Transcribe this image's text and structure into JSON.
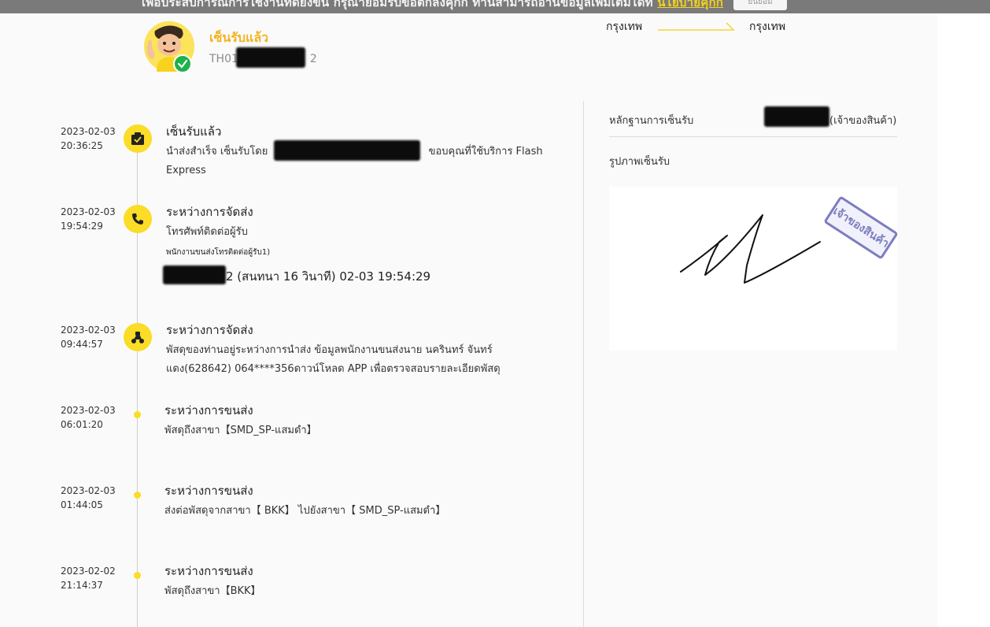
{
  "cookie_bar": {
    "text": "เพื่อประสบการณ์การใช้งานที่ดียิ่งขึ้น กรุณายอมรับข้อตกลงคุกกี้ ท่านสามารถอ่านข้อมูลเพิ่มเติมได้ที่",
    "link": "นโยบายคุกกี้",
    "accept_label": "ยินยอม"
  },
  "header": {
    "status_title": "เซ็นรับแล้ว",
    "tracking_prefix": "TH01",
    "tracking_suffix": "2",
    "route_from": "กรุงเทพ",
    "route_to": "กรุงเทพ"
  },
  "timeline": [
    {
      "date": "2023-02-03",
      "time": "20:36:25",
      "title": "เซ็นรับแล้ว",
      "desc_line1_a": "นำส่งสำเร็จ เซ็นรับโดย",
      "desc_line1_b": "ขอบคุณที่ใช้บริการ Flash",
      "desc_line2": "Express",
      "icon": "package-check-icon"
    },
    {
      "date": "2023-02-03",
      "time": "19:54:29",
      "title": "ระหว่างการจัดส่ง",
      "desc": "โทรศัพท์ติดต่อผู้รับ",
      "sub": "พนักงานขนส่งโทรติดต่อผู้รับ1)",
      "call_info": "2 (สนทนา 16 วินาที) 02-03 19:54:29",
      "icon": "phone-icon"
    },
    {
      "date": "2023-02-03",
      "time": "09:44:57",
      "title": "ระหว่างการจัดส่ง",
      "desc_line1": "พัสดุของท่านอยู่ระหว่างการนำส่ง ข้อมูลพนักงานขนส่งนาย นครินทร์ จันทร์",
      "desc_line2": "แดง(628642) 064****356ดาวน์โหลด APP เพื่อตรวจสอบรายละเอียดพัสดุ",
      "icon": "scooter-icon"
    },
    {
      "date": "2023-02-03",
      "time": "06:01:20",
      "title": "ระหว่างการขนส่ง",
      "desc": "พัสดุถึงสาขา【SMD_SP-แสมดำ】"
    },
    {
      "date": "2023-02-03",
      "time": "01:44:05",
      "title": "ระหว่างการขนส่ง",
      "desc": "ส่งต่อพัสดุจากสาขา【 BKK】 ไปยังสาขา【 SMD_SP-แสมดำ】"
    },
    {
      "date": "2023-02-02",
      "time": "21:14:37",
      "title": "ระหว่างการขนส่ง",
      "desc": "พัสดุถึงสาขา【BKK】"
    }
  ],
  "proof": {
    "label": "หลักฐานการเซ็นรับ",
    "owner": "(เจ้าของสินค้า)",
    "photo_label": "รูปภาพเซ็นรับ",
    "stamp_text": "เจ้าของสินค้า"
  }
}
